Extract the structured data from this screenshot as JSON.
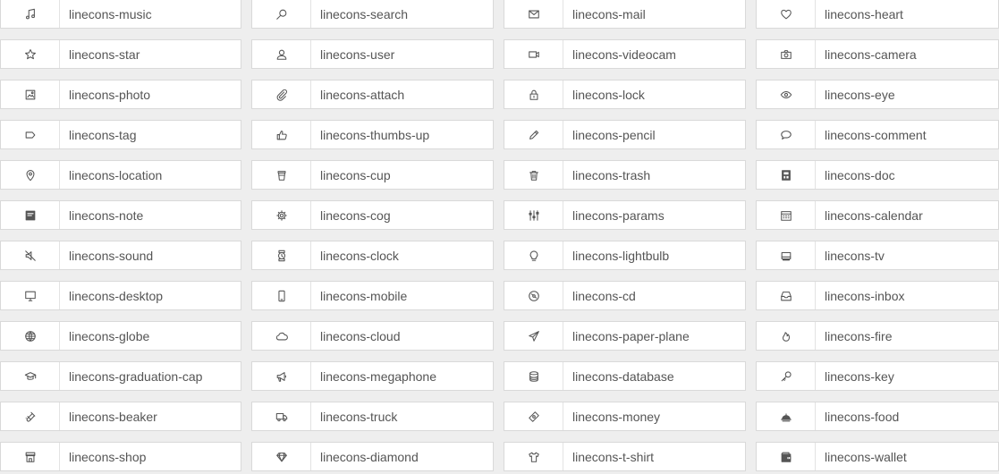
{
  "icons": [
    {
      "label": "linecons-music",
      "icon": "music-icon"
    },
    {
      "label": "linecons-search",
      "icon": "search-icon"
    },
    {
      "label": "linecons-mail",
      "icon": "mail-icon"
    },
    {
      "label": "linecons-heart",
      "icon": "heart-icon"
    },
    {
      "label": "linecons-star",
      "icon": "star-icon"
    },
    {
      "label": "linecons-user",
      "icon": "user-icon"
    },
    {
      "label": "linecons-videocam",
      "icon": "videocam-icon"
    },
    {
      "label": "linecons-camera",
      "icon": "camera-icon"
    },
    {
      "label": "linecons-photo",
      "icon": "photo-icon"
    },
    {
      "label": "linecons-attach",
      "icon": "attach-icon"
    },
    {
      "label": "linecons-lock",
      "icon": "lock-icon"
    },
    {
      "label": "linecons-eye",
      "icon": "eye-icon"
    },
    {
      "label": "linecons-tag",
      "icon": "tag-icon"
    },
    {
      "label": "linecons-thumbs-up",
      "icon": "thumbs-up-icon"
    },
    {
      "label": "linecons-pencil",
      "icon": "pencil-icon"
    },
    {
      "label": "linecons-comment",
      "icon": "comment-icon"
    },
    {
      "label": "linecons-location",
      "icon": "location-icon"
    },
    {
      "label": "linecons-cup",
      "icon": "cup-icon"
    },
    {
      "label": "linecons-trash",
      "icon": "trash-icon"
    },
    {
      "label": "linecons-doc",
      "icon": "doc-icon"
    },
    {
      "label": "linecons-note",
      "icon": "note-icon"
    },
    {
      "label": "linecons-cog",
      "icon": "cog-icon"
    },
    {
      "label": "linecons-params",
      "icon": "params-icon"
    },
    {
      "label": "linecons-calendar",
      "icon": "calendar-icon"
    },
    {
      "label": "linecons-sound",
      "icon": "sound-icon"
    },
    {
      "label": "linecons-clock",
      "icon": "clock-icon"
    },
    {
      "label": "linecons-lightbulb",
      "icon": "lightbulb-icon"
    },
    {
      "label": "linecons-tv",
      "icon": "tv-icon"
    },
    {
      "label": "linecons-desktop",
      "icon": "desktop-icon"
    },
    {
      "label": "linecons-mobile",
      "icon": "mobile-icon"
    },
    {
      "label": "linecons-cd",
      "icon": "cd-icon"
    },
    {
      "label": "linecons-inbox",
      "icon": "inbox-icon"
    },
    {
      "label": "linecons-globe",
      "icon": "globe-icon"
    },
    {
      "label": "linecons-cloud",
      "icon": "cloud-icon"
    },
    {
      "label": "linecons-paper-plane",
      "icon": "paper-plane-icon"
    },
    {
      "label": "linecons-fire",
      "icon": "fire-icon"
    },
    {
      "label": "linecons-graduation-cap",
      "icon": "graduation-cap-icon"
    },
    {
      "label": "linecons-megaphone",
      "icon": "megaphone-icon"
    },
    {
      "label": "linecons-database",
      "icon": "database-icon"
    },
    {
      "label": "linecons-key",
      "icon": "key-icon"
    },
    {
      "label": "linecons-beaker",
      "icon": "beaker-icon"
    },
    {
      "label": "linecons-truck",
      "icon": "truck-icon"
    },
    {
      "label": "linecons-money",
      "icon": "money-icon"
    },
    {
      "label": "linecons-food",
      "icon": "food-icon"
    },
    {
      "label": "linecons-shop",
      "icon": "shop-icon"
    },
    {
      "label": "linecons-diamond",
      "icon": "diamond-icon"
    },
    {
      "label": "linecons-t-shirt",
      "icon": "t-shirt-icon"
    },
    {
      "label": "linecons-wallet",
      "icon": "wallet-icon"
    }
  ],
  "colors": {
    "background": "#eeeeee",
    "cell": "#ffffff",
    "border": "#d9d9d9",
    "text": "#555555"
  }
}
